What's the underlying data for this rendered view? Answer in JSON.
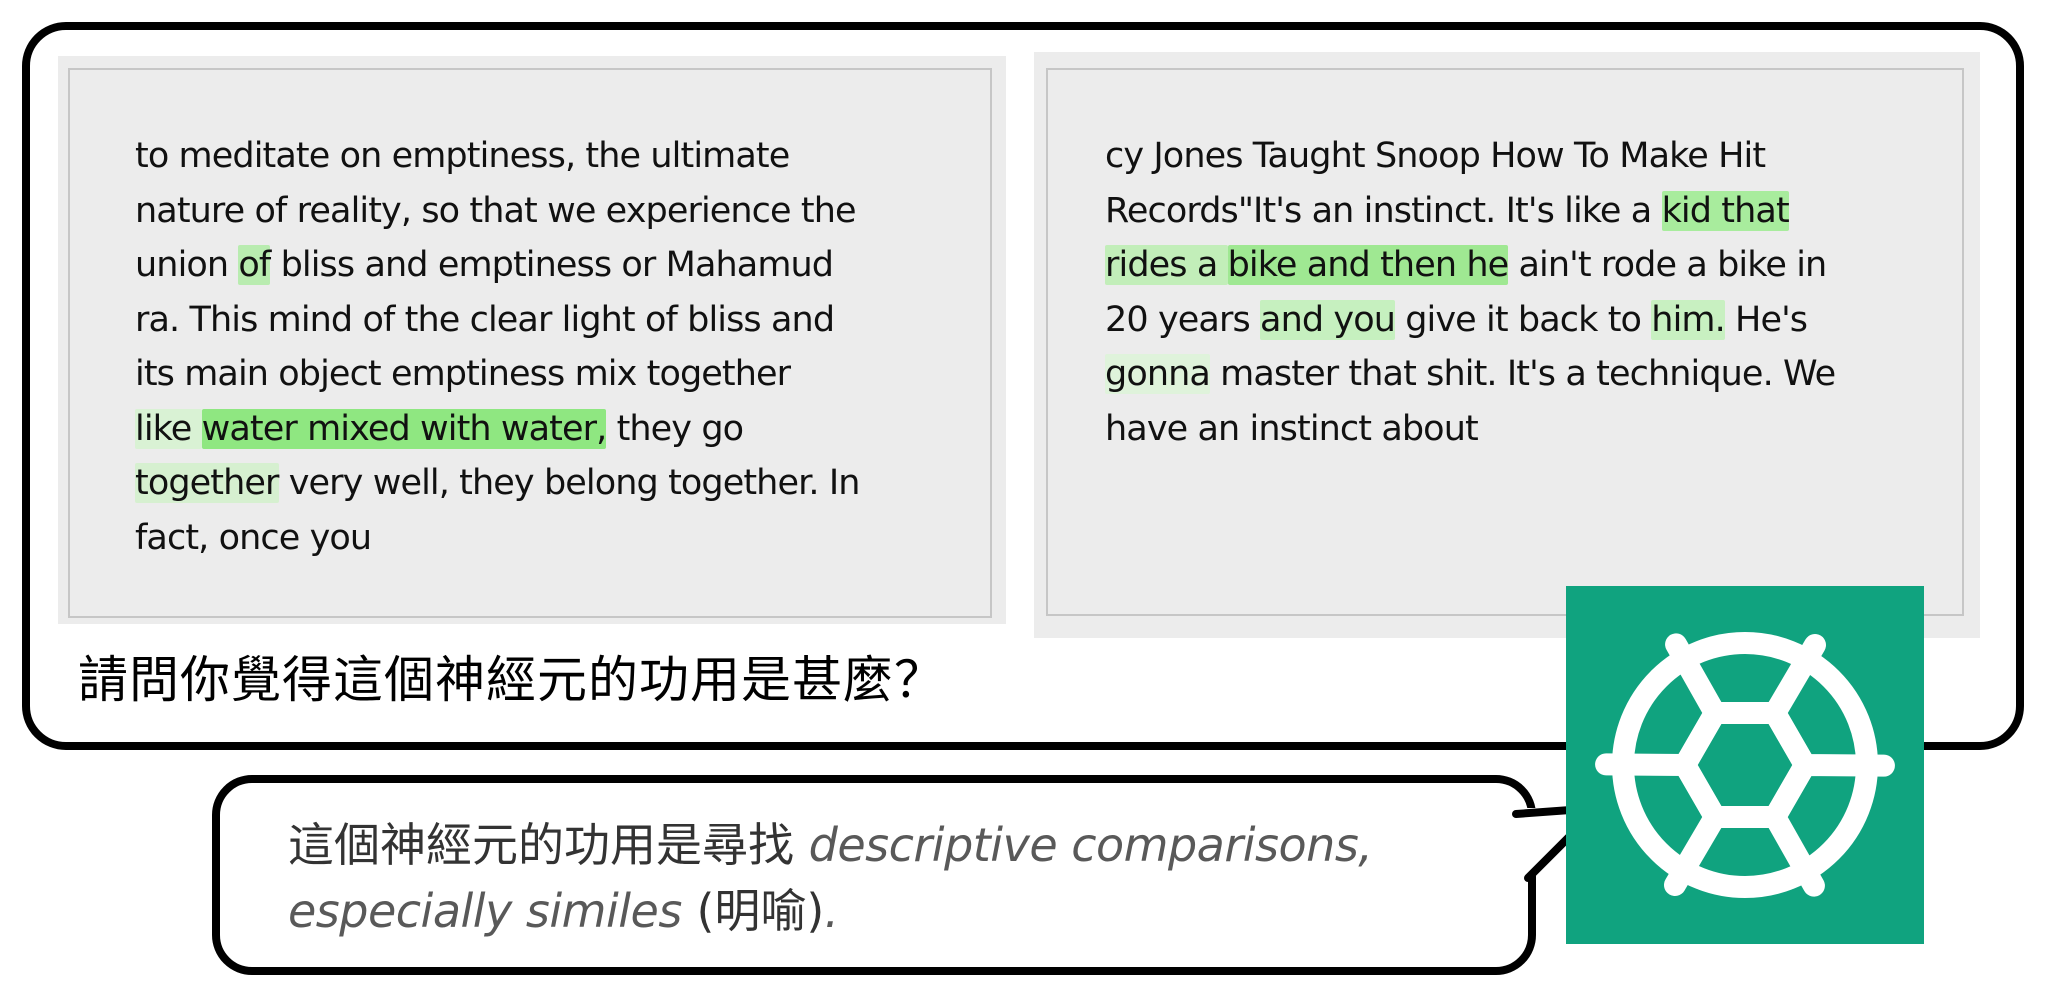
{
  "left_passage": {
    "lines": [
      [
        {
          "t": "to meditate on emptiness, the ultimate"
        }
      ],
      [
        {
          "t": "nature of reality, so that we experience the"
        }
      ],
      [
        {
          "t": "union "
        },
        {
          "t": "of",
          "h": "#b9ecb0"
        },
        {
          "t": " bliss and emptiness or Mahamud"
        }
      ],
      [
        {
          "t": "ra. This mind of the clear light of bliss and"
        }
      ],
      [
        {
          "t": "its main object emptiness mix together"
        }
      ],
      [
        {
          "t": "like ",
          "h": "#d9f2d4"
        },
        {
          "t": "water mixed with water,",
          "h": "#8fe781"
        },
        {
          "t": " they go"
        }
      ],
      [
        {
          "t": "together",
          "h": "#d6f0d0"
        },
        {
          "t": " very well, they belong together. In"
        }
      ],
      [
        {
          "t": "fact, once you"
        }
      ]
    ]
  },
  "right_passage": {
    "lines": [
      [
        {
          "t": "cy Jones Taught Snoop How To Make Hit"
        }
      ],
      [
        {
          "t": "Records\"It's an instinct. It's like a "
        },
        {
          "t": "kid that",
          "h": "#a8ec9d"
        }
      ],
      [
        {
          "t": "rides a ",
          "h": "#c2eeb9"
        },
        {
          "t": "bike and then he",
          "h": "#9fe892"
        },
        {
          "t": " ain't rode a bike in"
        }
      ],
      [
        {
          "t": "20 years "
        },
        {
          "t": "and you",
          "h": "#c6f0bf"
        },
        {
          "t": " give it back to "
        },
        {
          "t": "him.",
          "h": "#c8f0c1"
        },
        {
          "t": " He's"
        }
      ],
      [
        {
          "t": "gonna",
          "h": "#dff3db"
        },
        {
          "t": " master that shit. It's a technique. We"
        }
      ],
      [
        {
          "t": "have an instinct about"
        }
      ]
    ]
  },
  "question": "請問你覺得這個神經元的功用是甚麼？",
  "answer": {
    "prefix": "這個神經元的功用是尋找 ",
    "emphasis_1": "descriptive comparisons,",
    "emphasis_2": "especially similes",
    "suffix": " (明喻)",
    "final_period": "."
  },
  "colors": {
    "logo_background": "#10a37f",
    "panel_background": "#ececec",
    "highlight_strong": "#8fe781",
    "highlight_light": "#d9f2d4"
  },
  "icons": {
    "assistant_logo": "openai-logo-icon"
  }
}
